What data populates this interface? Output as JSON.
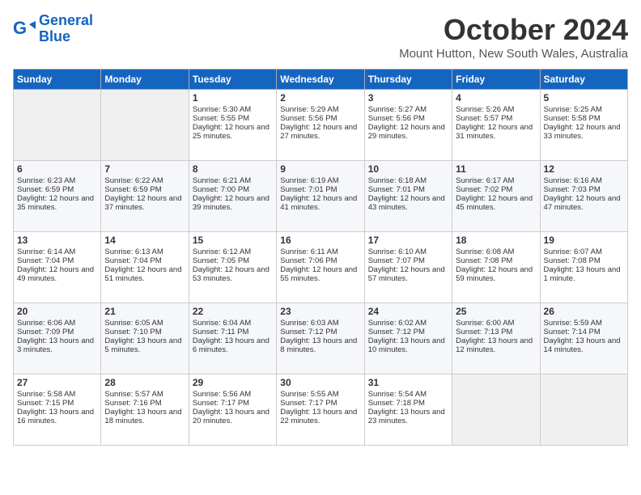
{
  "header": {
    "logo_line1": "General",
    "logo_line2": "Blue",
    "month": "October 2024",
    "location": "Mount Hutton, New South Wales, Australia"
  },
  "days_of_week": [
    "Sunday",
    "Monday",
    "Tuesday",
    "Wednesday",
    "Thursday",
    "Friday",
    "Saturday"
  ],
  "weeks": [
    [
      {
        "day": "",
        "sunrise": "",
        "sunset": "",
        "daylight": "",
        "empty": true
      },
      {
        "day": "",
        "sunrise": "",
        "sunset": "",
        "daylight": "",
        "empty": true
      },
      {
        "day": "1",
        "sunrise": "Sunrise: 5:30 AM",
        "sunset": "Sunset: 5:55 PM",
        "daylight": "Daylight: 12 hours and 25 minutes.",
        "empty": false
      },
      {
        "day": "2",
        "sunrise": "Sunrise: 5:29 AM",
        "sunset": "Sunset: 5:56 PM",
        "daylight": "Daylight: 12 hours and 27 minutes.",
        "empty": false
      },
      {
        "day": "3",
        "sunrise": "Sunrise: 5:27 AM",
        "sunset": "Sunset: 5:56 PM",
        "daylight": "Daylight: 12 hours and 29 minutes.",
        "empty": false
      },
      {
        "day": "4",
        "sunrise": "Sunrise: 5:26 AM",
        "sunset": "Sunset: 5:57 PM",
        "daylight": "Daylight: 12 hours and 31 minutes.",
        "empty": false
      },
      {
        "day": "5",
        "sunrise": "Sunrise: 5:25 AM",
        "sunset": "Sunset: 5:58 PM",
        "daylight": "Daylight: 12 hours and 33 minutes.",
        "empty": false
      }
    ],
    [
      {
        "day": "6",
        "sunrise": "Sunrise: 6:23 AM",
        "sunset": "Sunset: 6:59 PM",
        "daylight": "Daylight: 12 hours and 35 minutes.",
        "empty": false
      },
      {
        "day": "7",
        "sunrise": "Sunrise: 6:22 AM",
        "sunset": "Sunset: 6:59 PM",
        "daylight": "Daylight: 12 hours and 37 minutes.",
        "empty": false
      },
      {
        "day": "8",
        "sunrise": "Sunrise: 6:21 AM",
        "sunset": "Sunset: 7:00 PM",
        "daylight": "Daylight: 12 hours and 39 minutes.",
        "empty": false
      },
      {
        "day": "9",
        "sunrise": "Sunrise: 6:19 AM",
        "sunset": "Sunset: 7:01 PM",
        "daylight": "Daylight: 12 hours and 41 minutes.",
        "empty": false
      },
      {
        "day": "10",
        "sunrise": "Sunrise: 6:18 AM",
        "sunset": "Sunset: 7:01 PM",
        "daylight": "Daylight: 12 hours and 43 minutes.",
        "empty": false
      },
      {
        "day": "11",
        "sunrise": "Sunrise: 6:17 AM",
        "sunset": "Sunset: 7:02 PM",
        "daylight": "Daylight: 12 hours and 45 minutes.",
        "empty": false
      },
      {
        "day": "12",
        "sunrise": "Sunrise: 6:16 AM",
        "sunset": "Sunset: 7:03 PM",
        "daylight": "Daylight: 12 hours and 47 minutes.",
        "empty": false
      }
    ],
    [
      {
        "day": "13",
        "sunrise": "Sunrise: 6:14 AM",
        "sunset": "Sunset: 7:04 PM",
        "daylight": "Daylight: 12 hours and 49 minutes.",
        "empty": false
      },
      {
        "day": "14",
        "sunrise": "Sunrise: 6:13 AM",
        "sunset": "Sunset: 7:04 PM",
        "daylight": "Daylight: 12 hours and 51 minutes.",
        "empty": false
      },
      {
        "day": "15",
        "sunrise": "Sunrise: 6:12 AM",
        "sunset": "Sunset: 7:05 PM",
        "daylight": "Daylight: 12 hours and 53 minutes.",
        "empty": false
      },
      {
        "day": "16",
        "sunrise": "Sunrise: 6:11 AM",
        "sunset": "Sunset: 7:06 PM",
        "daylight": "Daylight: 12 hours and 55 minutes.",
        "empty": false
      },
      {
        "day": "17",
        "sunrise": "Sunrise: 6:10 AM",
        "sunset": "Sunset: 7:07 PM",
        "daylight": "Daylight: 12 hours and 57 minutes.",
        "empty": false
      },
      {
        "day": "18",
        "sunrise": "Sunrise: 6:08 AM",
        "sunset": "Sunset: 7:08 PM",
        "daylight": "Daylight: 12 hours and 59 minutes.",
        "empty": false
      },
      {
        "day": "19",
        "sunrise": "Sunrise: 6:07 AM",
        "sunset": "Sunset: 7:08 PM",
        "daylight": "Daylight: 13 hours and 1 minute.",
        "empty": false
      }
    ],
    [
      {
        "day": "20",
        "sunrise": "Sunrise: 6:06 AM",
        "sunset": "Sunset: 7:09 PM",
        "daylight": "Daylight: 13 hours and 3 minutes.",
        "empty": false
      },
      {
        "day": "21",
        "sunrise": "Sunrise: 6:05 AM",
        "sunset": "Sunset: 7:10 PM",
        "daylight": "Daylight: 13 hours and 5 minutes.",
        "empty": false
      },
      {
        "day": "22",
        "sunrise": "Sunrise: 6:04 AM",
        "sunset": "Sunset: 7:11 PM",
        "daylight": "Daylight: 13 hours and 6 minutes.",
        "empty": false
      },
      {
        "day": "23",
        "sunrise": "Sunrise: 6:03 AM",
        "sunset": "Sunset: 7:12 PM",
        "daylight": "Daylight: 13 hours and 8 minutes.",
        "empty": false
      },
      {
        "day": "24",
        "sunrise": "Sunrise: 6:02 AM",
        "sunset": "Sunset: 7:12 PM",
        "daylight": "Daylight: 13 hours and 10 minutes.",
        "empty": false
      },
      {
        "day": "25",
        "sunrise": "Sunrise: 6:00 AM",
        "sunset": "Sunset: 7:13 PM",
        "daylight": "Daylight: 13 hours and 12 minutes.",
        "empty": false
      },
      {
        "day": "26",
        "sunrise": "Sunrise: 5:59 AM",
        "sunset": "Sunset: 7:14 PM",
        "daylight": "Daylight: 13 hours and 14 minutes.",
        "empty": false
      }
    ],
    [
      {
        "day": "27",
        "sunrise": "Sunrise: 5:58 AM",
        "sunset": "Sunset: 7:15 PM",
        "daylight": "Daylight: 13 hours and 16 minutes.",
        "empty": false
      },
      {
        "day": "28",
        "sunrise": "Sunrise: 5:57 AM",
        "sunset": "Sunset: 7:16 PM",
        "daylight": "Daylight: 13 hours and 18 minutes.",
        "empty": false
      },
      {
        "day": "29",
        "sunrise": "Sunrise: 5:56 AM",
        "sunset": "Sunset: 7:17 PM",
        "daylight": "Daylight: 13 hours and 20 minutes.",
        "empty": false
      },
      {
        "day": "30",
        "sunrise": "Sunrise: 5:55 AM",
        "sunset": "Sunset: 7:17 PM",
        "daylight": "Daylight: 13 hours and 22 minutes.",
        "empty": false
      },
      {
        "day": "31",
        "sunrise": "Sunrise: 5:54 AM",
        "sunset": "Sunset: 7:18 PM",
        "daylight": "Daylight: 13 hours and 23 minutes.",
        "empty": false
      },
      {
        "day": "",
        "sunrise": "",
        "sunset": "",
        "daylight": "",
        "empty": true
      },
      {
        "day": "",
        "sunrise": "",
        "sunset": "",
        "daylight": "",
        "empty": true
      }
    ]
  ]
}
